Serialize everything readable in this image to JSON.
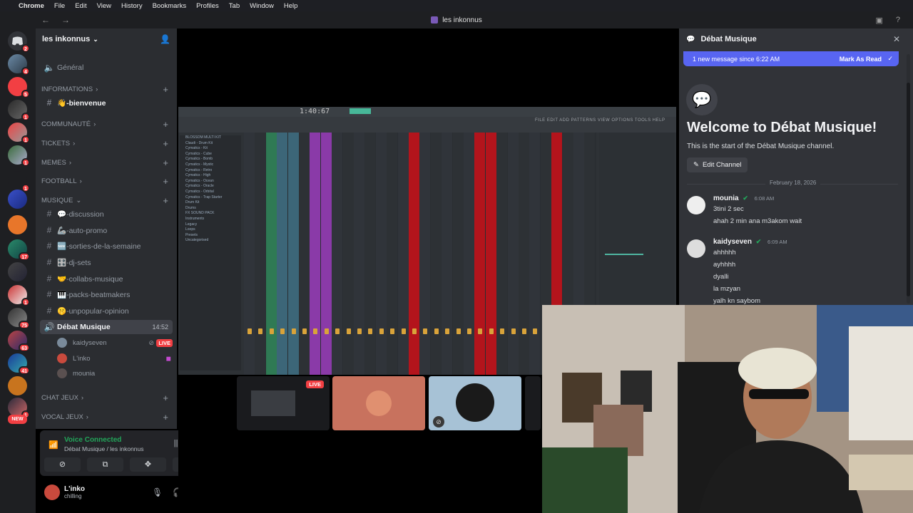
{
  "menubar": {
    "app": "Chrome",
    "items": [
      "File",
      "Edit",
      "View",
      "History",
      "Bookmarks",
      "Profiles",
      "Tab",
      "Window",
      "Help"
    ]
  },
  "titlebar": {
    "title": "les inkonnus"
  },
  "rail": {
    "badges": [
      "2",
      "4",
      "5",
      "1",
      "1",
      "1",
      "1",
      "17",
      "1",
      "2",
      "1",
      "75",
      "63",
      "41",
      "1"
    ],
    "new_label": "NEW"
  },
  "guild": {
    "name": "les inkonnus"
  },
  "channels": {
    "general": "Général",
    "cat_informations": "INFORMATIONS",
    "bienvenue": "👋-bienvenue",
    "cat_communaute": "COMMUNAUTÉ",
    "cat_tickets": "TICKETS",
    "cat_memes": "MEMES",
    "cat_football": "FOOTBALL",
    "cat_musique": "MUSIQUE",
    "discussion": "💬-discussion",
    "auto_promo": "🦾-auto-promo",
    "sorties": "🆕-sorties-de-la-semaine",
    "dj_sets": "🎛️-dj-sets",
    "collabs": "🤝-collabs-musique",
    "packs": "🎹-packs-beatmakers",
    "unpopular": "🤫-unpopular-opinion",
    "voice_channel": "Débat Musique",
    "voice_time": "14:52",
    "voice_users": [
      "kaidyseven",
      "L'inko",
      "mounia"
    ],
    "live_label": "LIVE",
    "cat_chat_jeux": "CHAT JEUX",
    "cat_vocal_jeux": "VOCAL JEUX"
  },
  "voice_panel": {
    "status": "Voice Connected",
    "location": "Débat Musique / les inkonnus"
  },
  "user_panel": {
    "name": "L'inko",
    "status": "chilling"
  },
  "daw": {
    "time": "1:40:67",
    "menu": "FILE EDIT ADD PATTERNS VIEW OPTIONS TOOLS HELP",
    "browser_items": [
      "BLOSSOM MULTI KIT",
      "Claudi - Drum Kit",
      "Cymatics - Kit",
      "Cymatics - Cube",
      "Cymatics - Bomb",
      "Cymatics - Mystic",
      "Cymatics - Retro",
      "Cymatics - High",
      "Cymatics - Ocean",
      "Cymatics - Oracle",
      "Cymatics - Orbital",
      "Cymatics - Trap Starter",
      "Drum Kit",
      "Drums",
      "FX SOUND PACK",
      "Instruments",
      "Legacy",
      "Loops",
      "Presets",
      "Uncategorised"
    ]
  },
  "tiles": {
    "live_label": "LIVE"
  },
  "chat": {
    "channel": "Débat Musique",
    "new_messages": "1 new message since 6:22 AM",
    "mark_read": "Mark As Read",
    "welcome_title": "Welcome to Débat Musique!",
    "welcome_sub": "This is the start of the Débat Musique channel.",
    "edit_channel": "Edit Channel",
    "date_divider": "February 18, 2026",
    "messages": [
      {
        "author": "mounia",
        "time": "6:08 AM",
        "lines": [
          "3tini 2 sec",
          "ahah 2 min ana m3akom wait"
        ]
      },
      {
        "author": "kaidyseven",
        "time": "6:09 AM",
        "lines": [
          "ahhhhh",
          "ayhhhh",
          "dyalli",
          "la mzyan",
          "yalh kn saybom"
        ]
      }
    ]
  },
  "colors": {
    "blurple": "#5865f2",
    "green": "#23a55a",
    "red": "#f23f43",
    "daw_purple": "#8a3aa8",
    "daw_red": "#b3141c",
    "daw_green": "#2f7a54"
  }
}
